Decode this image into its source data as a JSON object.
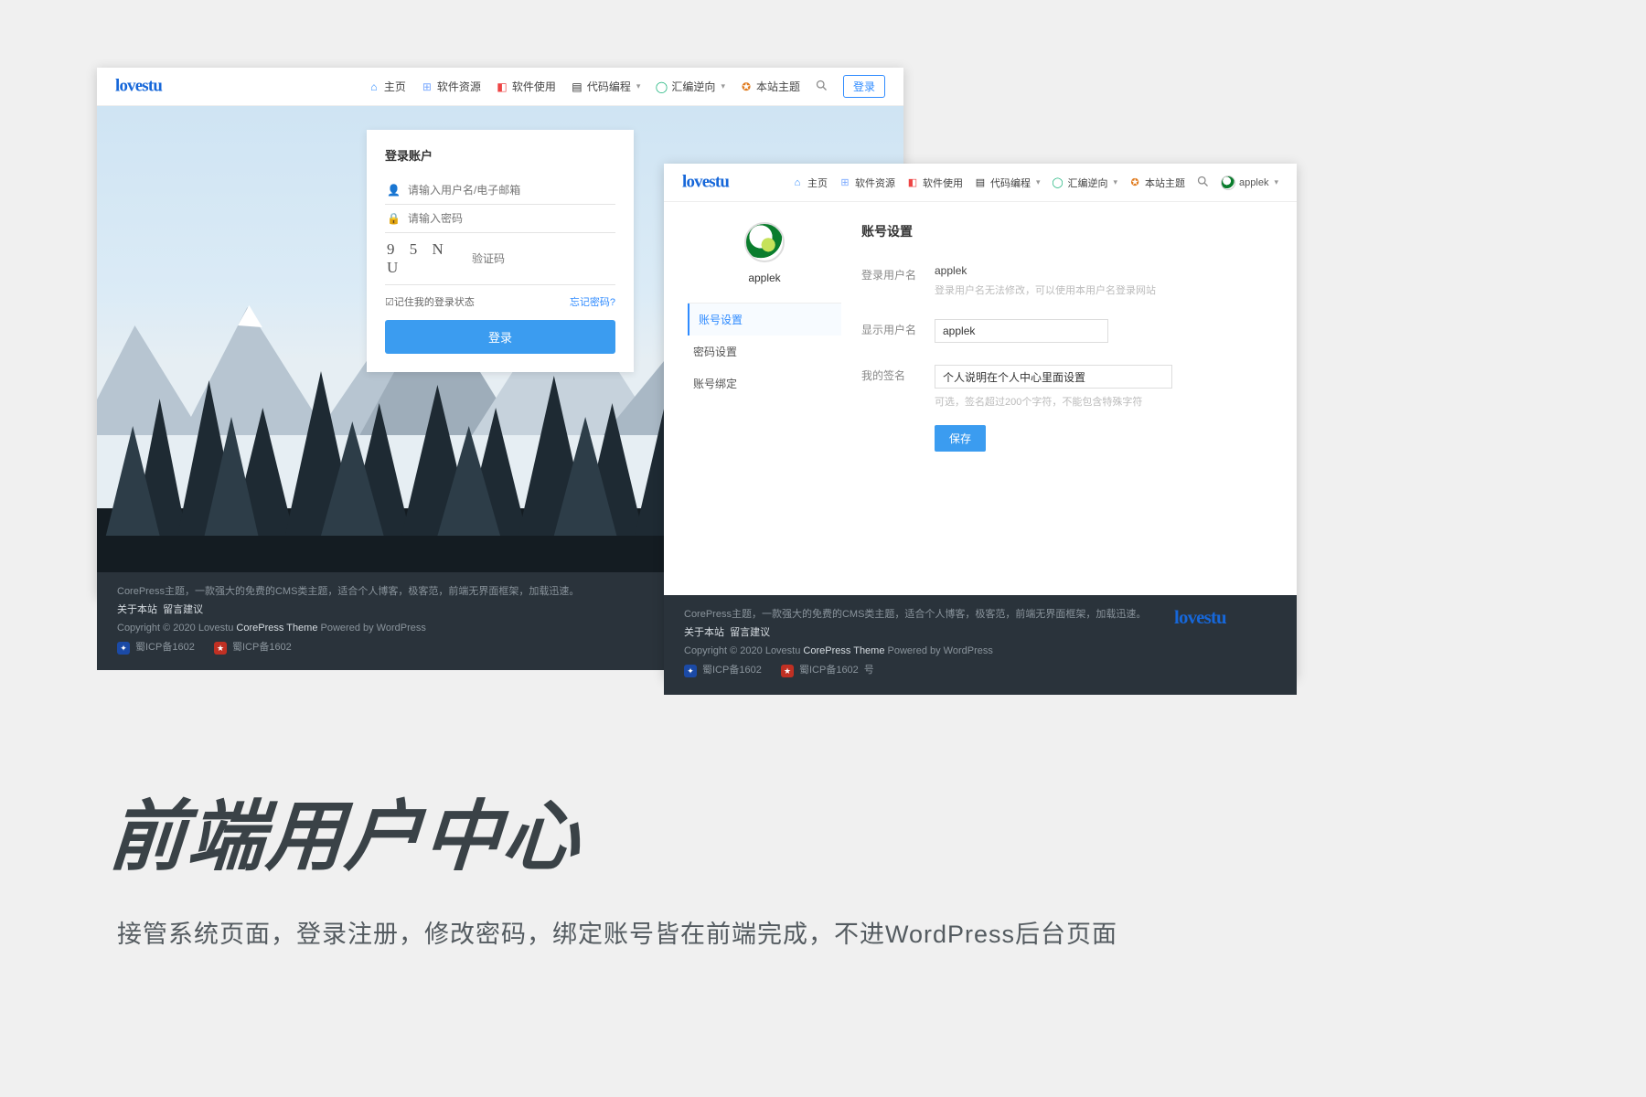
{
  "brand": "lovestu",
  "nav": {
    "home": "主页",
    "res": "软件资源",
    "use": "软件使用",
    "code": "代码编程",
    "rev": "汇编逆向",
    "theme": "本站主题",
    "login": "登录"
  },
  "login": {
    "title": "登录账户",
    "user_ph": "请输入用户名/电子邮箱",
    "pass_ph": "请输入密码",
    "captcha_code": "9 5 N U",
    "captcha_ph": "验证码",
    "remember_prefix": "☑",
    "remember": "记住我的登录状态",
    "forgot": "忘记密码?",
    "submit": "登录"
  },
  "footer": {
    "desc": "CorePress主题，一款强大的免费的CMS类主题，适合个人博客，极客范，前端无界面框架，加载迅速。",
    "links_a": "关于本站",
    "links_b": "留言建议",
    "copy_pre": "Copyright © 2020 Lovestu ",
    "copy_theme": "CorePress Theme",
    "copy_post": " Powered by WordPress",
    "icp1": "蜀ICP备1602",
    "icp2": "蜀ICP备1602",
    "icp2_suffix": "号"
  },
  "settings": {
    "username": "applek",
    "menu": {
      "acc": "账号设置",
      "pwd": "密码设置",
      "bind": "账号绑定"
    },
    "panel_title": "账号设置",
    "row1_label": "登录用户名",
    "row1_value": "applek",
    "row1_hint": "登录用户名无法修改，可以使用本用户名登录网站",
    "row2_label": "显示用户名",
    "row2_value": "applek",
    "row3_label": "我的签名",
    "row3_value": "个人说明在个人中心里面设置",
    "row3_hint": "可选，签名超过200个字符，不能包含特殊字符",
    "save": "保存"
  },
  "headline": "前端用户中心",
  "subline": "接管系统页面，登录注册，修改密码，绑定账号皆在前端完成，不进WordPress后台页面"
}
